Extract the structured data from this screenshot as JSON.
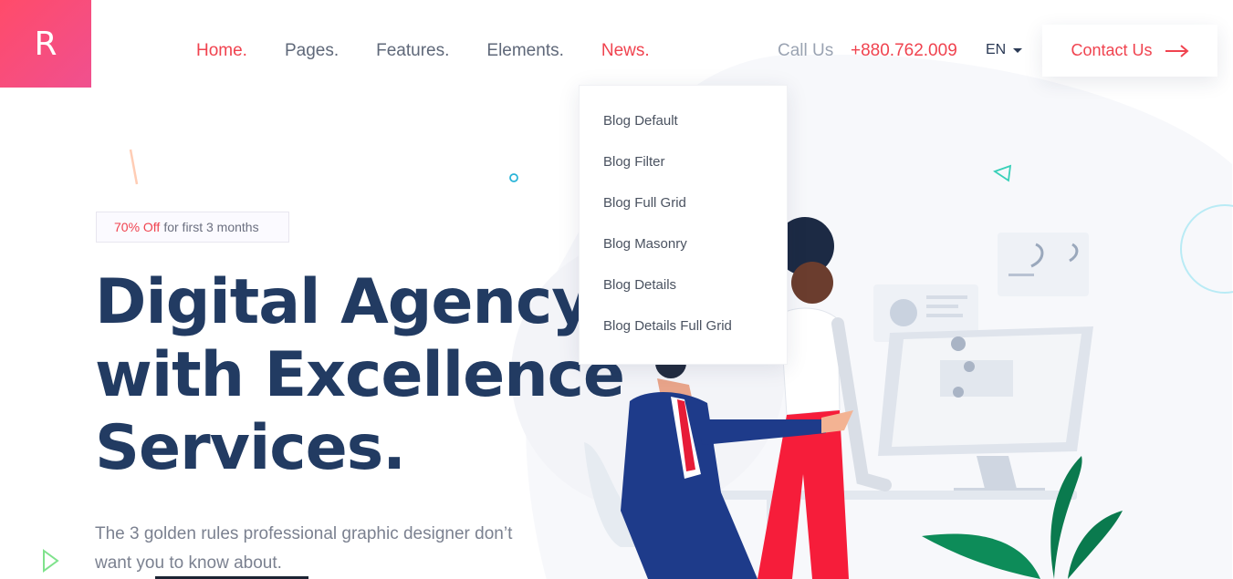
{
  "logo": {
    "letter": "R"
  },
  "nav": {
    "items": [
      {
        "label": "Home.",
        "active": true
      },
      {
        "label": "Pages.",
        "active": false
      },
      {
        "label": "Features.",
        "active": false
      },
      {
        "label": "Elements.",
        "active": false
      },
      {
        "label": "News.",
        "active": true
      }
    ]
  },
  "header": {
    "call_label": "Call Us",
    "phone": "+880.762.009",
    "language": "EN",
    "contact_label": "Contact Us"
  },
  "news_dropdown": {
    "items": [
      "Blog Default",
      "Blog Filter",
      "Blog Full Grid",
      "Blog Masonry",
      "Blog Details",
      "Blog Details Full Grid"
    ]
  },
  "hero": {
    "badge_highlight": "70% Off",
    "badge_text": "for first 3 months",
    "title_lines": [
      "Digital Agency",
      "with Excellence",
      "Services."
    ],
    "subtitle": "The 3 golden rules professional graphic designer don’t want you to know about."
  },
  "colors": {
    "accent": "#f0434f",
    "heading": "#223b62",
    "brand_gradient_start": "#ff4b6a",
    "brand_gradient_end": "#f0508f"
  },
  "icons": [
    "arrow-right-icon",
    "caret-down-icon",
    "play-icon",
    "triangle-icon",
    "ring-icon"
  ]
}
